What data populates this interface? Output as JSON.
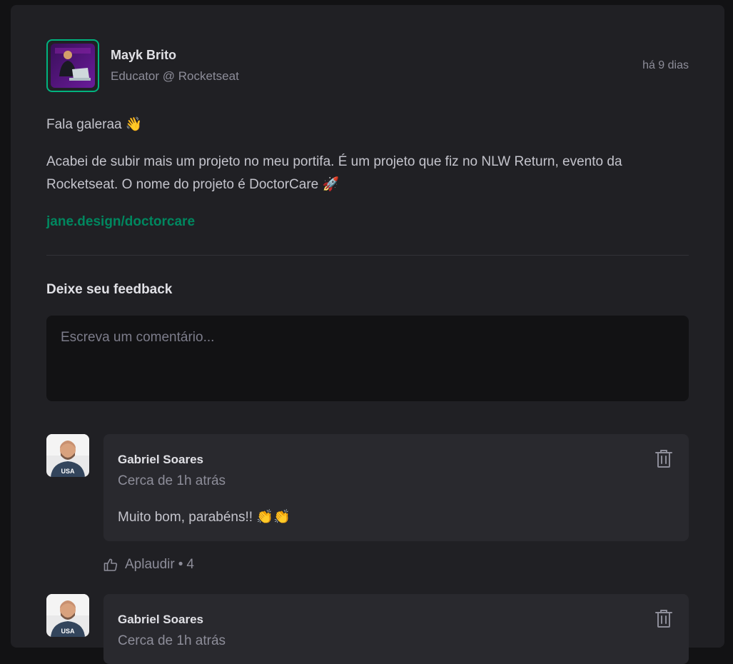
{
  "post": {
    "author": {
      "name": "Mayk Brito",
      "role": "Educator @ Rocketseat",
      "avatar": "avatar-photo"
    },
    "time": "há 9 dias",
    "content": {
      "greeting": "Fala galeraa 👋",
      "body": "Acabei de subir mais um projeto no meu portifa. É um projeto que fiz no NLW Return, evento da Rocketseat. O nome do projeto é DoctorCare 🚀",
      "link": "jane.design/doctorcare"
    },
    "feedback": {
      "title": "Deixe seu feedback",
      "placeholder": "Escreva um comentário..."
    },
    "comments": [
      {
        "author": "Gabriel Soares",
        "time": "Cerca de 1h atrás",
        "text": "Muito bom, parabéns!! 👏👏",
        "applaud_label": "Aplaudir",
        "separator": "•",
        "applaud_count": "4",
        "delete_icon": "trash-icon",
        "applaud_icon": "thumbs-up-icon"
      },
      {
        "author": "Gabriel Soares",
        "time": "Cerca de 1h atrás",
        "delete_icon": "trash-icon"
      }
    ]
  },
  "colors": {
    "background": "#121214",
    "card": "#202024",
    "comment_card": "#29292e",
    "accent": "#00875f",
    "avatar_border": "#00b37e"
  }
}
